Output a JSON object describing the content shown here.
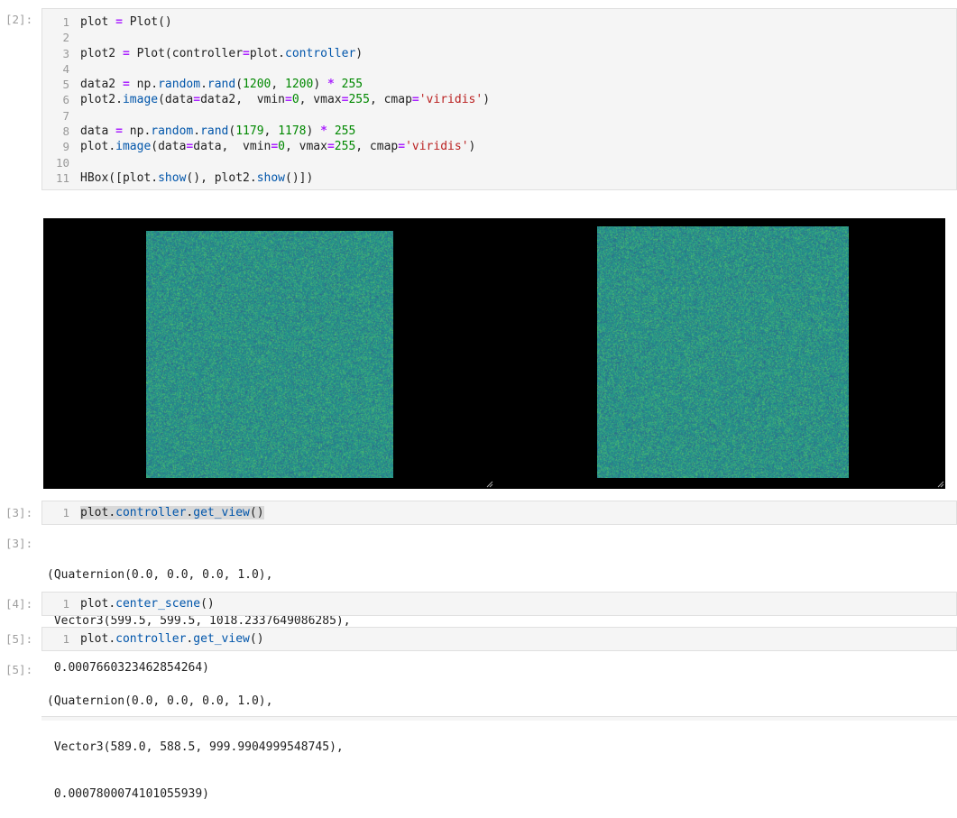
{
  "cells": [
    {
      "prompt": "[2]:",
      "lines": [
        {
          "n": "1"
        },
        {
          "n": "2"
        },
        {
          "n": "3"
        },
        {
          "n": "4"
        },
        {
          "n": "5"
        },
        {
          "n": "6"
        },
        {
          "n": "7"
        },
        {
          "n": "8"
        },
        {
          "n": "9"
        },
        {
          "n": "10"
        },
        {
          "n": "11"
        }
      ],
      "tokens": {
        "l1": [
          "plot ",
          "=",
          " Plot()"
        ],
        "l3": [
          "plot2 ",
          "=",
          " Plot(controller",
          "=",
          "plot",
          ".",
          "controller",
          ")"
        ],
        "l5": [
          "data2 ",
          "=",
          " np",
          ".",
          "random",
          ".",
          "rand",
          "(",
          "1200",
          ", ",
          "1200",
          ") ",
          "*",
          " ",
          "255"
        ],
        "l6": [
          "plot2",
          ".",
          "image",
          "(data",
          "=",
          "data2,  vmin",
          "=",
          "0",
          ", vmax",
          "=",
          "255",
          ", cmap",
          "=",
          "'viridis'",
          ")"
        ],
        "l8": [
          "data ",
          "=",
          " np",
          ".",
          "random",
          ".",
          "rand",
          "(",
          "1179",
          ", ",
          "1178",
          ") ",
          "*",
          " ",
          "255"
        ],
        "l9": [
          "plot",
          ".",
          "image",
          "(data",
          "=",
          "data,  vmin",
          "=",
          "0",
          ", vmax",
          "=",
          "255",
          ", cmap",
          "=",
          "'viridis'",
          ")"
        ],
        "l11": [
          "HBox([plot",
          ".",
          "show",
          "(), plot2",
          ".",
          "show",
          "()])"
        ]
      }
    },
    {
      "prompt": "[3]:",
      "n": "1",
      "tokens": [
        "plot",
        ".",
        "controller",
        ".",
        "get_view",
        "()"
      ]
    },
    {
      "out_prompt": "[3]:",
      "out_lines": [
        "(Quaternion(0.0, 0.0, 0.0, 1.0),",
        " Vector3(599.5, 599.5, 1018.2337649086285),",
        " 0.0007660323462854264)"
      ]
    },
    {
      "prompt": "[4]:",
      "n": "1",
      "tokens": [
        "plot",
        ".",
        "center_scene",
        "()"
      ]
    },
    {
      "prompt": "[5]:",
      "n": "1",
      "tokens": [
        "plot",
        ".",
        "controller",
        ".",
        "get_view",
        "()"
      ]
    },
    {
      "out_prompt": "[5]:",
      "out_lines": [
        "(Quaternion(0.0, 0.0, 0.0, 1.0),",
        " Vector3(589.0, 588.5, 999.9904999548745),",
        " 0.0007800074101055939)"
      ]
    }
  ],
  "colors": {
    "viridis_base": "#2a8c89",
    "canvas_bg": "#000000"
  },
  "icons": {
    "resize_handle": "resize-handle-icon"
  }
}
